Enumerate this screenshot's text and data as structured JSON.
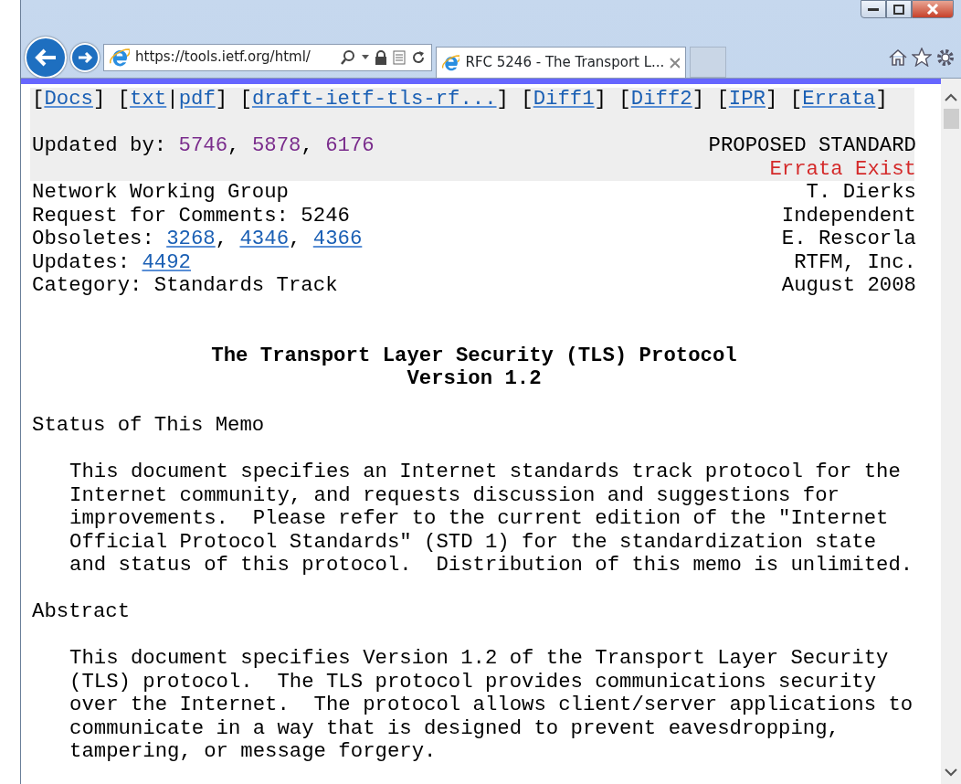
{
  "browser": {
    "address": "https://tools.ietf.org/html/",
    "tabs": [
      {
        "title": "RFC 5246 - The Transport L...",
        "selected": true
      }
    ]
  },
  "document": {
    "nav": [
      {
        "kind": "text",
        "text": "["
      },
      {
        "kind": "link",
        "text": "Docs",
        "visited": false
      },
      {
        "kind": "text",
        "text": "] ["
      },
      {
        "kind": "link",
        "text": "txt",
        "visited": false
      },
      {
        "kind": "text",
        "text": "|"
      },
      {
        "kind": "link",
        "text": "pdf",
        "visited": false
      },
      {
        "kind": "text",
        "text": "] ["
      },
      {
        "kind": "link",
        "text": "draft-ietf-tls-rf...",
        "visited": false
      },
      {
        "kind": "text",
        "text": "] ["
      },
      {
        "kind": "link",
        "text": "Diff1",
        "visited": false
      },
      {
        "kind": "text",
        "text": "] ["
      },
      {
        "kind": "link",
        "text": "Diff2",
        "visited": false
      },
      {
        "kind": "text",
        "text": "] ["
      },
      {
        "kind": "link",
        "text": "IPR",
        "visited": false
      },
      {
        "kind": "text",
        "text": "] ["
      },
      {
        "kind": "link",
        "text": "Errata",
        "visited": false
      },
      {
        "kind": "text",
        "text": "]"
      }
    ],
    "meta_rows": [
      {
        "left": [
          {
            "kind": "text",
            "text": "Updated by: "
          },
          {
            "kind": "link",
            "text": "5746",
            "visited": true
          },
          {
            "kind": "text",
            "text": ", "
          },
          {
            "kind": "link",
            "text": "5878",
            "visited": true
          },
          {
            "kind": "text",
            "text": ", "
          },
          {
            "kind": "link",
            "text": "6176",
            "visited": true
          }
        ],
        "right": {
          "text": "PROPOSED STANDARD",
          "kind": "status"
        }
      },
      {
        "left": [],
        "right": {
          "text": "Errata Exist",
          "kind": "errata"
        }
      }
    ],
    "header_rows": [
      {
        "left": [
          {
            "kind": "text",
            "text": "Network Working Group"
          }
        ],
        "right": "T. Dierks"
      },
      {
        "left": [
          {
            "kind": "text",
            "text": "Request for Comments: 5246"
          }
        ],
        "right": "Independent"
      },
      {
        "left": [
          {
            "kind": "text",
            "text": "Obsoletes: "
          },
          {
            "kind": "link",
            "text": "3268",
            "visited": false
          },
          {
            "kind": "text",
            "text": ", "
          },
          {
            "kind": "link",
            "text": "4346",
            "visited": false
          },
          {
            "kind": "text",
            "text": ", "
          },
          {
            "kind": "link",
            "text": "4366",
            "visited": false
          }
        ],
        "right": "E. Rescorla"
      },
      {
        "left": [
          {
            "kind": "text",
            "text": "Updates: "
          },
          {
            "kind": "link",
            "text": "4492",
            "visited": false
          }
        ],
        "right": "RTFM, Inc."
      },
      {
        "left": [
          {
            "kind": "text",
            "text": "Category: Standards Track"
          }
        ],
        "right": "August 2008"
      }
    ],
    "title_lines": [
      "The Transport Layer Security (TLS) Protocol",
      "Version 1.2"
    ],
    "sections": [
      {
        "heading": "Status of This Memo",
        "lines": [
          "This document specifies an Internet standards track protocol for the",
          "Internet community, and requests discussion and suggestions for",
          "improvements.  Please refer to the current edition of the \"Internet",
          "Official Protocol Standards\" (STD 1) for the standardization state",
          "and status of this protocol.  Distribution of this memo is unlimited."
        ]
      },
      {
        "heading": "Abstract",
        "lines": [
          "This document specifies Version 1.2 of the Transport Layer Security",
          "(TLS) protocol.  The TLS protocol provides communications security",
          "over the Internet.  The protocol allows client/server applications to",
          "communicate in a way that is designed to prevent eavesdropping,",
          "tampering, or message forgery."
        ]
      }
    ]
  }
}
